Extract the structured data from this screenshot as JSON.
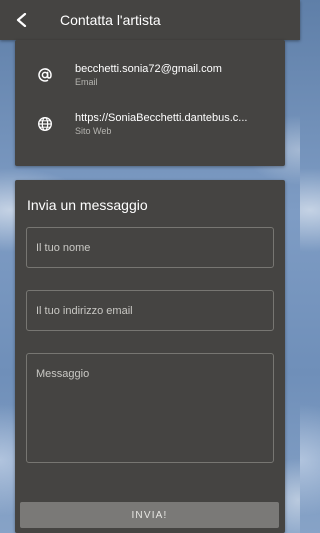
{
  "header": {
    "title": "Contatta l'artista",
    "back_icon": "back-arrow-icon"
  },
  "contact_info": {
    "email": {
      "value": "becchetti.sonia72@gmail.com",
      "label": "Email",
      "icon": "at-sign-icon"
    },
    "website": {
      "value": "https://SoniaBecchetti.dantebus.c...",
      "label": "Sito Web",
      "icon": "globe-icon"
    }
  },
  "form": {
    "title": "Invia un messaggio",
    "name_placeholder": "Il tuo nome",
    "email_placeholder": "Il tuo indirizzo email",
    "message_placeholder": "Messaggio",
    "submit_label": "INVIA!"
  },
  "colors": {
    "card_bg": "#454442",
    "text": "#ffffff",
    "secondary_text": "#b5b4b0",
    "button_bg": "#7a7977"
  }
}
